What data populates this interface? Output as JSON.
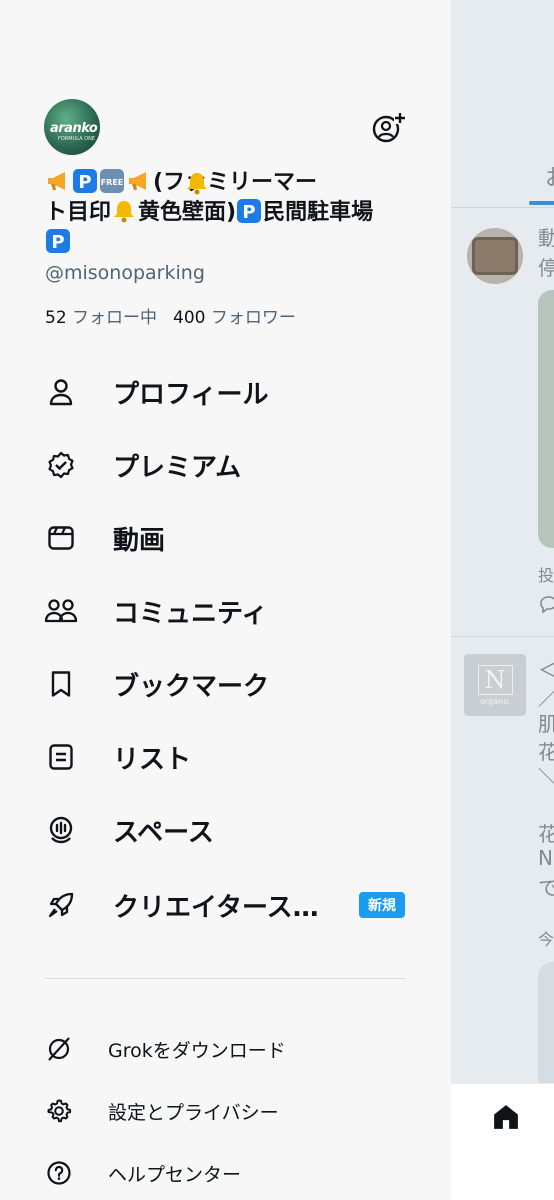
{
  "profile": {
    "name_line1": "(ファミリーマー",
    "name_line2_a": "ト目印",
    "name_line2_b": "黄色壁面)",
    "name_line2_c": "民間駐車場",
    "handle": "@misonoparking",
    "following_count": "52",
    "following_label": "フォロー中",
    "followers_count": "400",
    "followers_label": "フォロワー",
    "avatar_text": "aranko",
    "avatar_subtext": "FORMULA ONE"
  },
  "menu": [
    {
      "label": "プロフィール",
      "icon": "person-icon"
    },
    {
      "label": "プレミアム",
      "icon": "verified-badge-icon"
    },
    {
      "label": "動画",
      "icon": "video-icon"
    },
    {
      "label": "コミュニティ",
      "icon": "communities-icon"
    },
    {
      "label": "ブックマーク",
      "icon": "bookmark-icon"
    },
    {
      "label": "リスト",
      "icon": "list-icon"
    },
    {
      "label": "スペース",
      "icon": "spaces-icon"
    },
    {
      "label": "クリエイタース…",
      "icon": "rocket-icon",
      "badge": "新規"
    }
  ],
  "secondary_menu": [
    {
      "label": "Grokをダウンロード",
      "icon": "grok-icon"
    },
    {
      "label": "設定とプライバシー",
      "icon": "gear-icon"
    },
    {
      "label": "ヘルプセンター",
      "icon": "help-icon"
    }
  ],
  "background": {
    "tab_char": "お",
    "text_lines": [
      "動",
      "停",
      "投",
      "＜",
      "／",
      "肌",
      "花",
      "＼",
      "花",
      "N",
      "で",
      "今"
    ],
    "logo_text": "N",
    "logo_sub": "organic"
  },
  "colors": {
    "accent": "#1d9bf0",
    "text": "#0f1419",
    "secondary_text": "#536471",
    "drawer_bg": "#f7f7f8"
  }
}
